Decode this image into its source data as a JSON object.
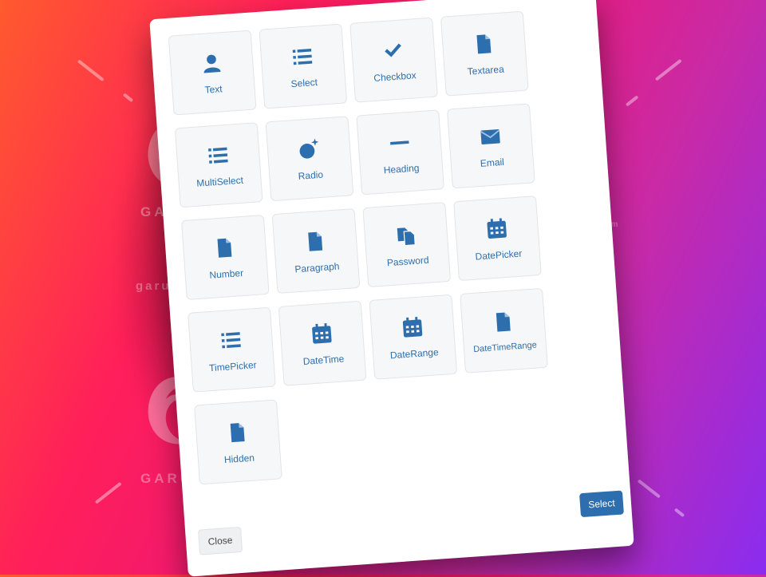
{
  "watermark": {
    "brand": "GARUDEYA",
    "dotcom": ".com",
    "domain": "garudeya.com"
  },
  "modal": {
    "tiles": [
      {
        "label": "Text",
        "icon": "person-icon"
      },
      {
        "label": "Select",
        "icon": "list-icon"
      },
      {
        "label": "Checkbox",
        "icon": "checkmark-icon"
      },
      {
        "label": "Textarea",
        "icon": "file-icon"
      },
      {
        "label": "MultiSelect",
        "icon": "list-icon"
      },
      {
        "label": "Radio",
        "icon": "sparkle-ball-icon"
      },
      {
        "label": "Heading",
        "icon": "minus-icon"
      },
      {
        "label": "Email",
        "icon": "envelope-icon"
      },
      {
        "label": "Number",
        "icon": "file-icon"
      },
      {
        "label": "Paragraph",
        "icon": "file-icon"
      },
      {
        "label": "Password",
        "icon": "copy-icon"
      },
      {
        "label": "DatePicker",
        "icon": "calendar-icon"
      },
      {
        "label": "TimePicker",
        "icon": "list-icon"
      },
      {
        "label": "DateTime",
        "icon": "calendar-icon"
      },
      {
        "label": "DateRange",
        "icon": "calendar-icon"
      },
      {
        "label": "DateTimeRange",
        "icon": "file-icon"
      },
      {
        "label": "Hidden",
        "icon": "file-icon"
      }
    ],
    "close_label": "Close",
    "select_label": "Select"
  },
  "colors": {
    "accent": "#2d6fae",
    "tile_bg": "#f6f7f9",
    "tile_border": "#e1e4e8"
  }
}
